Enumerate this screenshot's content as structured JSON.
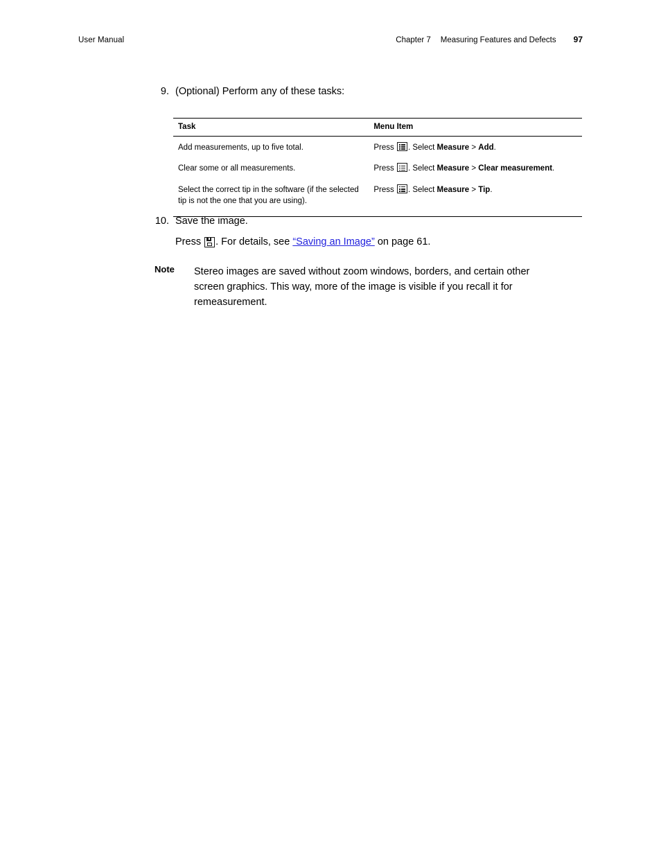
{
  "header": {
    "left": "User Manual",
    "chapter": "Chapter 7",
    "chapter_title": "Measuring Features and Defects",
    "page_number": "97"
  },
  "steps": {
    "step9": {
      "number": "9.",
      "text": "(Optional) Perform any of these tasks:"
    },
    "step10": {
      "number": "10.",
      "text": "Save the image.",
      "press_word": "Press",
      "detail_prefix": ". For details, see ",
      "link_text": "“Saving an Image”",
      "detail_suffix": " on page 61."
    }
  },
  "table": {
    "columns": [
      "Task",
      "Menu Item"
    ],
    "rows": [
      {
        "task": "Add measurements, up to five total.",
        "press": "Press",
        "menu_prefix": ". Select ",
        "menu": "Measure",
        "separator": " > ",
        "menu_item": "Add",
        "period": "."
      },
      {
        "task": "Clear some or all measurements.",
        "press": "Press",
        "menu_prefix": ". Select ",
        "menu": "Measure",
        "separator": " > ",
        "menu_item": "Clear measurement",
        "period": "."
      },
      {
        "task": "Select the correct tip in the software (if the selected tip is not the one that you are using).",
        "press": "Press",
        "menu_prefix": ". Select ",
        "menu": "Measure",
        "separator": " > ",
        "menu_item": "Tip",
        "period": "."
      }
    ]
  },
  "note": {
    "label": "Note",
    "body": "Stereo images are saved without zoom windows, borders, and certain other screen graphics. This way, more of the image is visible if you recall it for remeasurement."
  },
  "colors": {
    "link": "#2222dd",
    "text": "#000000",
    "rule": "#000000"
  },
  "icons": {
    "menu": "menu-list-icon",
    "save": "floppy-save-icon"
  }
}
